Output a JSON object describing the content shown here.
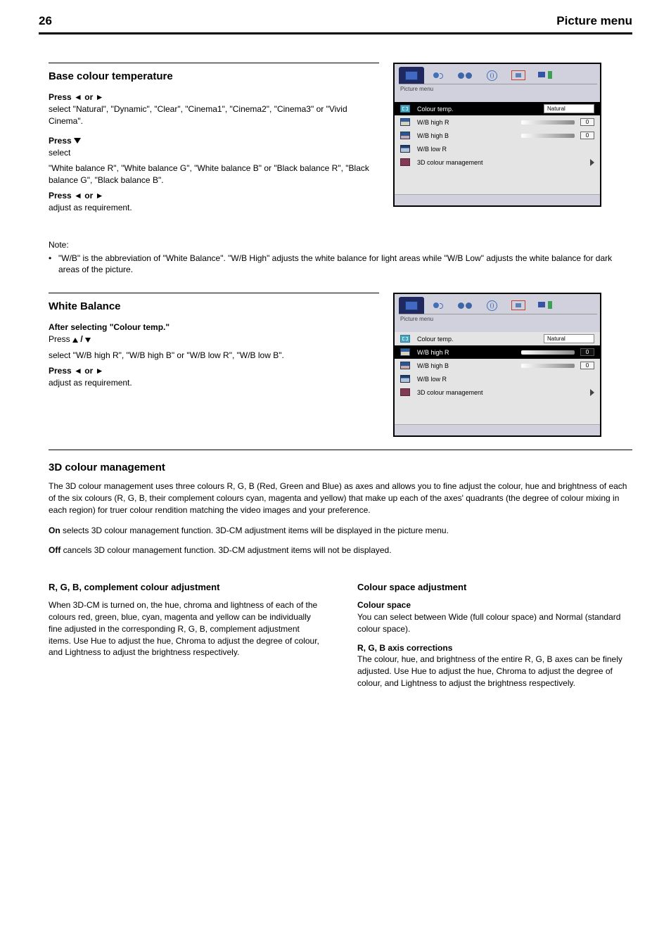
{
  "page_number": "26",
  "page_title": "Picture menu",
  "section1": {
    "heading": "Base colour temperature",
    "step1_label": "Press ◄ or ►",
    "step1_body": "select \"Natural\", \"Dynamic\", \"Clear\", \"Cinema1\", \"Cinema2\", \"Cinema3\" or \"Vivid Cinema\".",
    "step2_label": "Press ▼",
    "step2_body_a": "select",
    "step2_body_b": "\"White balance R\", \"White balance G\", \"White balance B\" or \"Black balance R\", \"Black balance G\", \"Black balance B\".",
    "step3_label": "Press ◄ or ►",
    "step3_body": "adjust as requirement.",
    "note_intro": "Note:",
    "note_body": "\"W/B\" is the abbreviation of \"White Balance\". \"W/B High\" adjusts the white balance for light areas while \"W/B Low\" adjusts the white balance for dark areas of the picture."
  },
  "menu1": {
    "title": "Picture menu",
    "rows": {
      "r0": "Colour temp.",
      "r0_val": "Natural",
      "r1": "W/B high R",
      "r1_val": "0",
      "r2": "W/B high B",
      "r2_val": "0",
      "r3": "W/B low R",
      "r4": "3D colour management"
    }
  },
  "section2": {
    "heading": "White Balance",
    "step1_label": "After selecting \"Colour temp.\"",
    "step1_body_a": "Press ▲ / ▼",
    "step1_body_b": "select \"W/B high R\", \"W/B high B\" or \"W/B low R\", \"W/B low B\".",
    "step2_label": "Press ◄ or ►",
    "step2_body": "adjust as requirement."
  },
  "menu2": {
    "title": "Picture menu",
    "rows": {
      "r0": "Colour temp.",
      "r0_val": "Natural",
      "r1": "W/B high R",
      "r1_val": "0",
      "r2": "W/B high B",
      "r2_val": "0",
      "r3": "W/B low R",
      "r4": "3D colour management"
    }
  },
  "section3": {
    "heading": "3D colour management",
    "intro": "The 3D colour management uses three colours R, G, B (Red, Green and Blue) as axes and allows you to fine adjust the colour, hue and brightness of each of the six colours (R, G, B, their complement colours cyan, magenta and yellow) that make up each of the axes' quadrants (the degree of colour mixing in each region) for truer colour rendition matching the video images and your preference.",
    "on_para": "selects 3D colour management function. 3D-CM adjustment items will be displayed in the picture menu.",
    "off_para": "cancels 3D colour management function. 3D-CM adjustment items will not be displayed."
  },
  "col_left": {
    "heading": "R, G, B, complement colour adjustment",
    "para": "When 3D-CM is turned on, the hue, chroma and lightness of each of the colours red, green, blue, cyan, magenta and yellow can be individually fine adjusted in the corresponding R, G, B, complement adjustment items. Use Hue to adjust the hue, Chroma to adjust the degree of colour, and Lightness to adjust the brightness respectively."
  },
  "col_right": {
    "heading": "Colour space adjustment",
    "p1": "Colour space",
    "p1_body": "You can select between Wide (full colour space) and Normal (standard colour space).",
    "p2": "R, G, B axis corrections",
    "p2_body": "The colour, hue, and brightness of the entire R, G, B axes can be finely adjusted. Use Hue to adjust the hue, Chroma to adjust the degree of colour, and Lightness to adjust the brightness respectively."
  }
}
